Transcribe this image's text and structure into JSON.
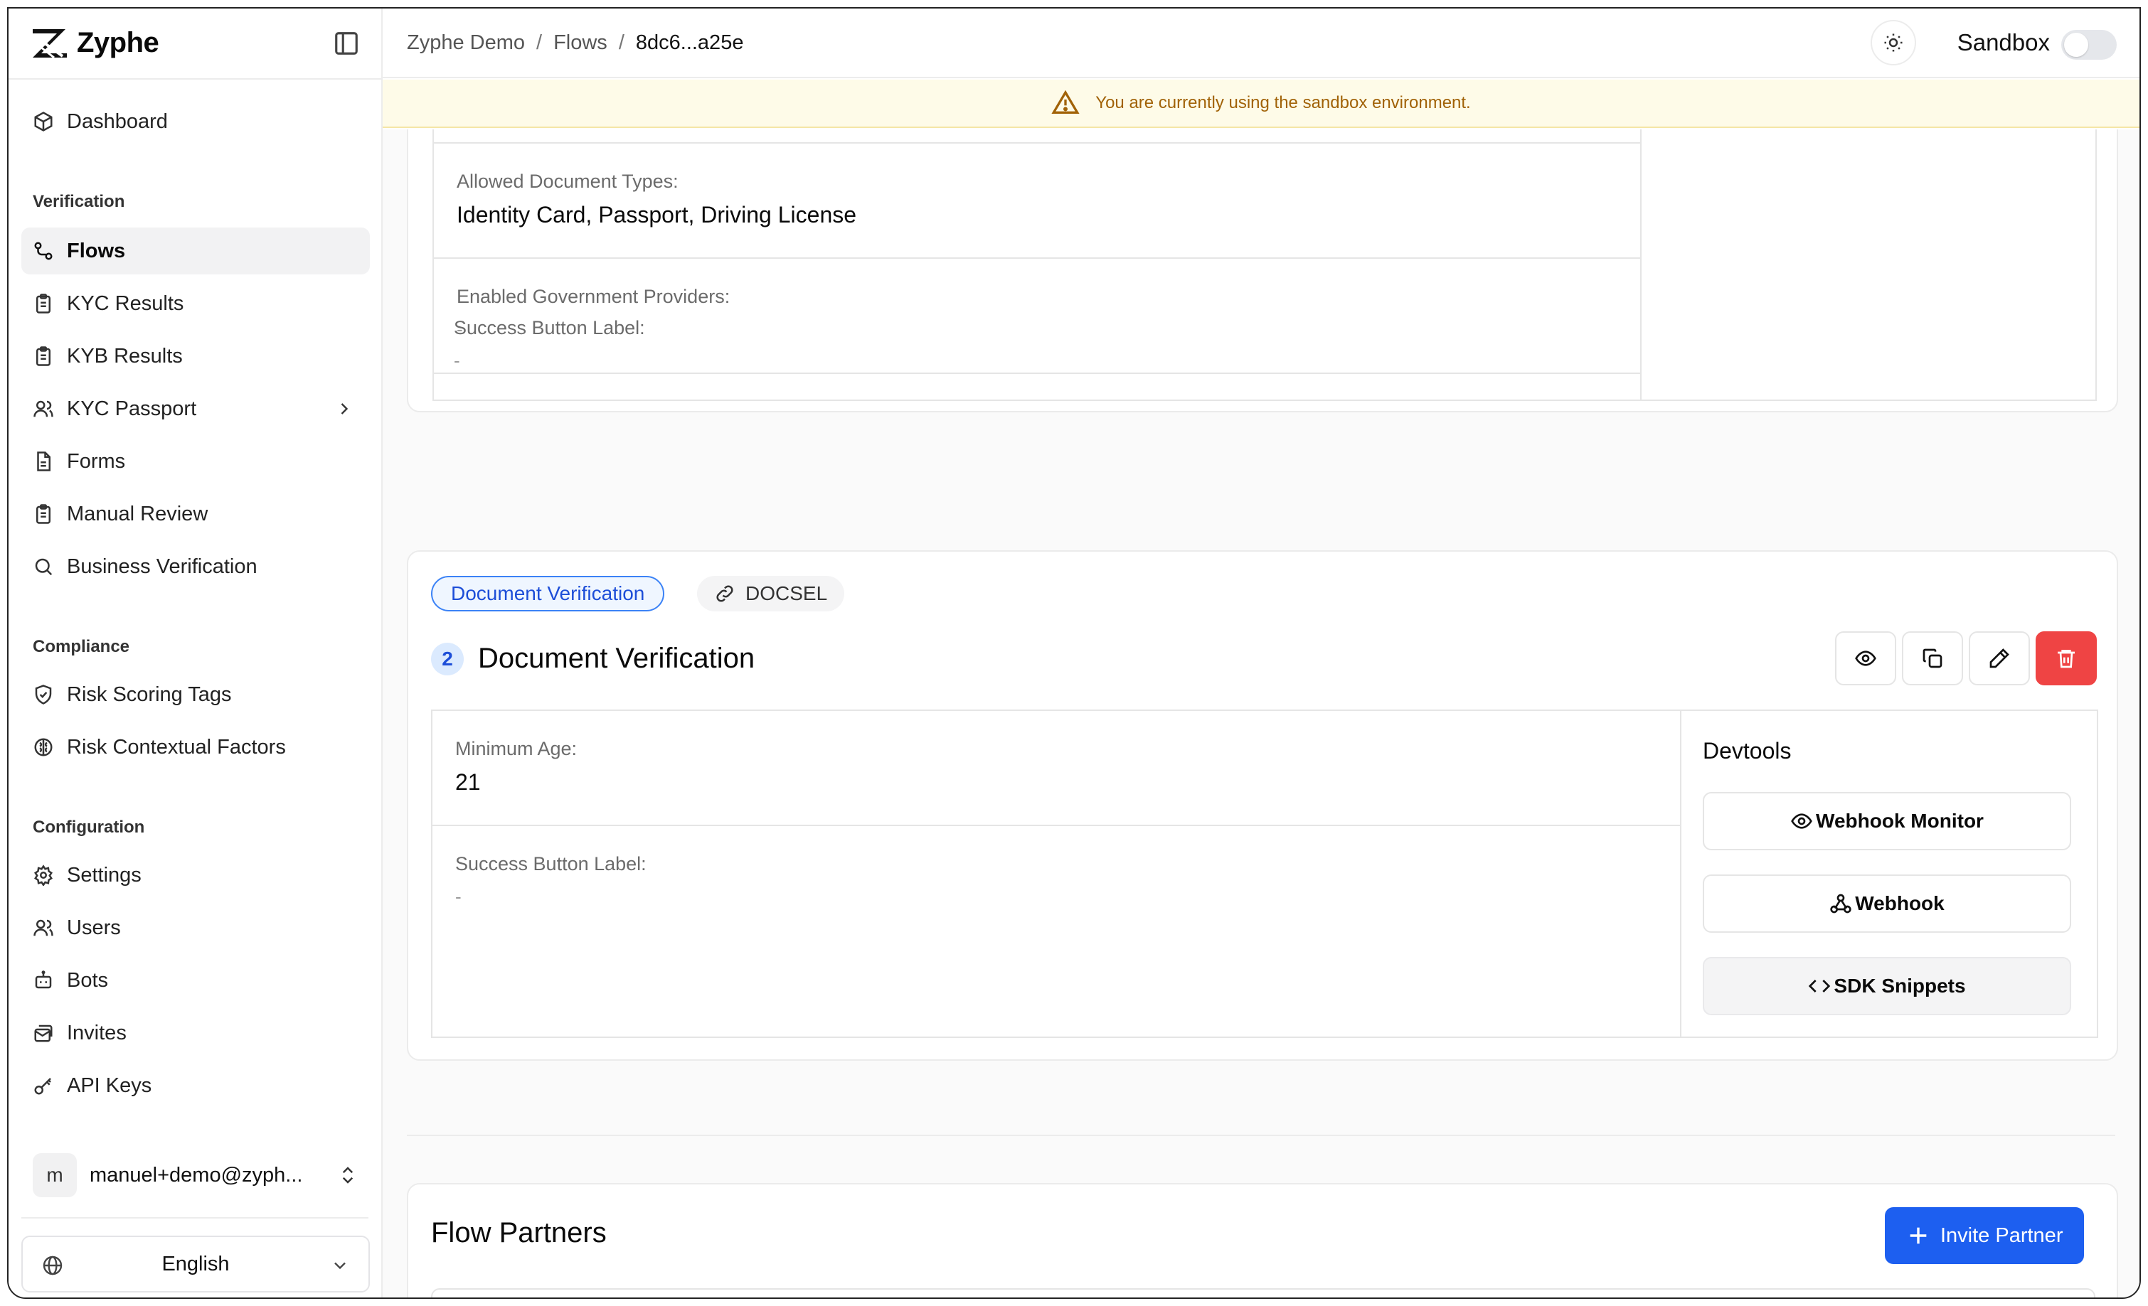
{
  "app": {
    "name": "Zyphe"
  },
  "sidebar": {
    "dashboard": "Dashboard",
    "groups": {
      "verification": "Verification",
      "compliance": "Compliance",
      "configuration": "Configuration"
    },
    "items": [
      {
        "label": "Flows",
        "icon": "flow-icon",
        "active": true
      },
      {
        "label": "KYC Results",
        "icon": "clipboard-icon"
      },
      {
        "label": "KYB Results",
        "icon": "clipboard-icon"
      },
      {
        "label": "KYC Passport",
        "icon": "users-icon"
      },
      {
        "label": "Forms",
        "icon": "file-text-icon"
      },
      {
        "label": "Manual Review",
        "icon": "clipboard-icon"
      },
      {
        "label": "Business Verification",
        "icon": "search-icon"
      },
      {
        "label": "Risk Scoring Tags",
        "icon": "shield-check-icon"
      },
      {
        "label": "Risk Contextual Factors",
        "icon": "brain-icon"
      },
      {
        "label": "Settings",
        "icon": "gear-icon"
      },
      {
        "label": "Users",
        "icon": "users-icon"
      },
      {
        "label": "Bots",
        "icon": "bot-icon"
      },
      {
        "label": "Invites",
        "icon": "mail-stack-icon"
      },
      {
        "label": "API Keys",
        "icon": "key-icon"
      }
    ],
    "user": {
      "initial": "m",
      "email": "manuel+demo@zyph..."
    },
    "language": "English"
  },
  "header": {
    "breadcrumb": [
      "Zyphe Demo",
      "Flows",
      "8dc6...a25e"
    ],
    "environment_label": "Sandbox",
    "sandbox_enabled": false
  },
  "banner": {
    "text": "You are currently using the sandbox environment."
  },
  "step1": {
    "fields": [
      {
        "label": "Allowed Document Types:",
        "value": "Identity Card, Passport, Driving License"
      },
      {
        "label": "Enabled Government Providers:",
        "value": "-"
      },
      {
        "label": "Success Button Label:",
        "value": "-"
      }
    ]
  },
  "step2": {
    "tag": "Document Verification",
    "code": "DOCSEL",
    "number": "2",
    "title": "Document Verification",
    "fields": [
      {
        "label": "Minimum Age:",
        "value": "21"
      },
      {
        "label": "Success Button Label:",
        "value": "-"
      }
    ],
    "devtools": {
      "title": "Devtools",
      "buttons": [
        "Webhook Monitor",
        "Webhook",
        "SDK Snippets"
      ]
    }
  },
  "partners": {
    "title": "Flow Partners",
    "invite_label": "Invite Partner"
  },
  "colors": {
    "primary": "#1d5ff0",
    "danger": "#ef4444",
    "banner_bg": "#fefbe8",
    "banner_text": "#a16207",
    "tag_blue": "#1d4ed8"
  }
}
